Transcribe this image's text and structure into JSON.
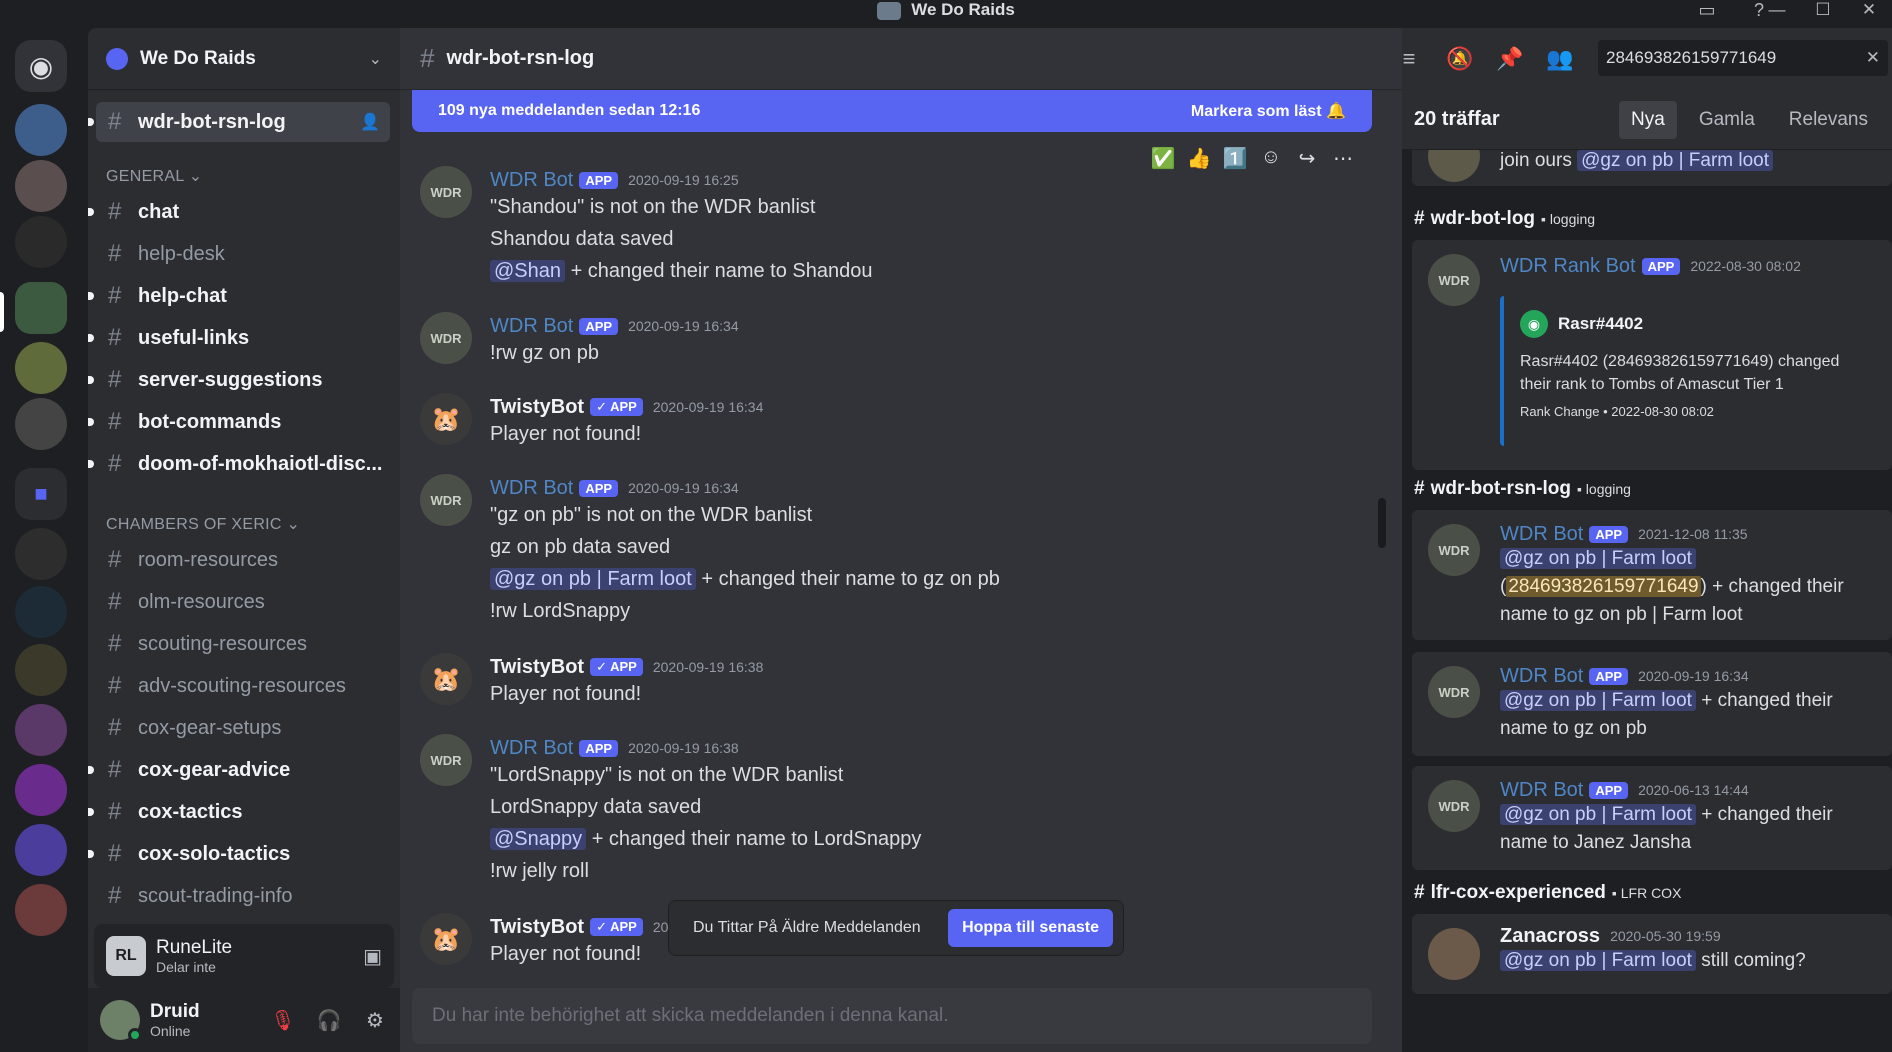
{
  "window": {
    "title": "We Do Raids",
    "controls": [
      "—",
      "☐",
      "✕"
    ]
  },
  "server": {
    "name": "We Do Raids"
  },
  "sidebar": {
    "active_channel": "wdr-bot-rsn-log",
    "cat_general": "GENERAL",
    "cat_cox": "CHAMBERS OF XERIC",
    "channels": [
      {
        "label": "chat"
      },
      {
        "label": "help-desk"
      },
      {
        "label": "help-chat"
      },
      {
        "label": "useful-links"
      },
      {
        "label": "server-suggestions"
      },
      {
        "label": "bot-commands"
      },
      {
        "label": "doom-of-mokhaiotl-disc..."
      },
      {
        "label": "room-resources"
      },
      {
        "label": "olm-resources"
      },
      {
        "label": "scouting-resources"
      },
      {
        "label": "adv-scouting-resources"
      },
      {
        "label": "cox-gear-setups"
      },
      {
        "label": "cox-gear-advice"
      },
      {
        "label": "cox-tactics"
      },
      {
        "label": "cox-solo-tactics"
      },
      {
        "label": "scout-trading-info"
      }
    ]
  },
  "voice": {
    "name": "RuneLite",
    "status": "Delar inte",
    "icon_text": "RL"
  },
  "user": {
    "name": "Druid",
    "status": "Online"
  },
  "chat": {
    "channel_name": "wdr-bot-rsn-log",
    "banner_text": "109 nya meddelanden sedan 12:16",
    "banner_action": "Markera som läst",
    "app_tag": "APP",
    "messages": [
      {
        "author": "WDR Bot",
        "ts": "2020-09-19 16:25",
        "lines": [
          "\"Shandou\" is not on the WDR banlist",
          "Shandou data saved"
        ],
        "mention": "@Shan",
        "mention_rest": " + changed their name to Shandou"
      },
      {
        "author": "WDR Bot",
        "ts": "2020-09-19 16:34",
        "lines": [
          "!rw gz on pb"
        ]
      },
      {
        "author": "TwistyBot",
        "ts": "2020-09-19 16:34",
        "lines": [
          "Player not found!"
        ]
      },
      {
        "author": "WDR Bot",
        "ts": "2020-09-19 16:34",
        "lines": [
          "\"gz on pb\" is not on the WDR banlist",
          "gz on pb data saved"
        ],
        "mention": "@gz on pb | Farm loot",
        "mention_rest": " + changed their name to gz on pb",
        "extra": "!rw LordSnappy"
      },
      {
        "author": "TwistyBot",
        "ts": "2020-09-19 16:38",
        "lines": [
          "Player not found!"
        ]
      },
      {
        "author": "WDR Bot",
        "ts": "2020-09-19 16:38",
        "lines": [
          "\"LordSnappy\" is not on the WDR banlist",
          "LordSnappy data saved"
        ],
        "mention": "@Snappy",
        "mention_rest": " + changed their name to LordSnappy",
        "extra": "!rw jelly roll"
      },
      {
        "author": "TwistyBot",
        "ts": "202",
        "lines": [
          "Player not found!"
        ]
      }
    ],
    "toast_text": "Du Tittar På Äldre Meddelanden",
    "toast_button": "Hoppa till senaste",
    "composer_placeholder": "Du har inte behörighet att skicka meddelanden i denna kanal."
  },
  "search": {
    "query": "284693826159771649",
    "result_count": "20 träffar",
    "tabs": [
      "Nya",
      "Gamla",
      "Relevans"
    ],
    "active_tab": "Nya",
    "top_snippet": {
      "prefix": "join ours",
      "mention": "@gz on pb | Farm loot"
    },
    "groups": [
      {
        "channel": "wdr-bot-log",
        "category": "logging"
      },
      {
        "channel": "wdr-bot-rsn-log",
        "category": "logging"
      },
      {
        "channel": "lfr-cox-experienced",
        "category": "LFR COX"
      }
    ],
    "results": [
      {
        "author": "WDR Rank Bot",
        "ts": "2022-08-30 08:02",
        "embed_title": "Rasr#4402",
        "embed_text": "Rasr#4402 (284693826159771649) changed their rank to Tombs of Amascut Tier 1",
        "embed_footer": "Rank Change • 2022-08-30 08:02"
      },
      {
        "author": "WDR Bot",
        "ts": "2021-12-08 11:35",
        "mention": "@gz on pb | Farm loot",
        "open_paren": "(",
        "highlight": "284693826159771649",
        "rest": ") + changed their",
        "line3": "name to gz on pb | Farm loot"
      },
      {
        "author": "WDR Bot",
        "ts": "2020-09-19 16:34",
        "mention": "@gz on pb | Farm loot",
        "rest": " + changed their",
        "line2": "name to gz on pb"
      },
      {
        "author": "WDR Bot",
        "ts": "2020-06-13 14:44",
        "mention": "@gz on pb | Farm loot",
        "rest": " + changed their",
        "line2": "name to Janez Jansha"
      },
      {
        "author": "Zanacross",
        "ts": "2020-05-30 19:59",
        "mention": "@gz on pb | Farm loot",
        "rest": " still coming?"
      }
    ]
  },
  "colors": {
    "accent": "#5865f2",
    "bot_name": "#4f86c6",
    "online": "#23a55a",
    "muted": "#f23f43"
  }
}
